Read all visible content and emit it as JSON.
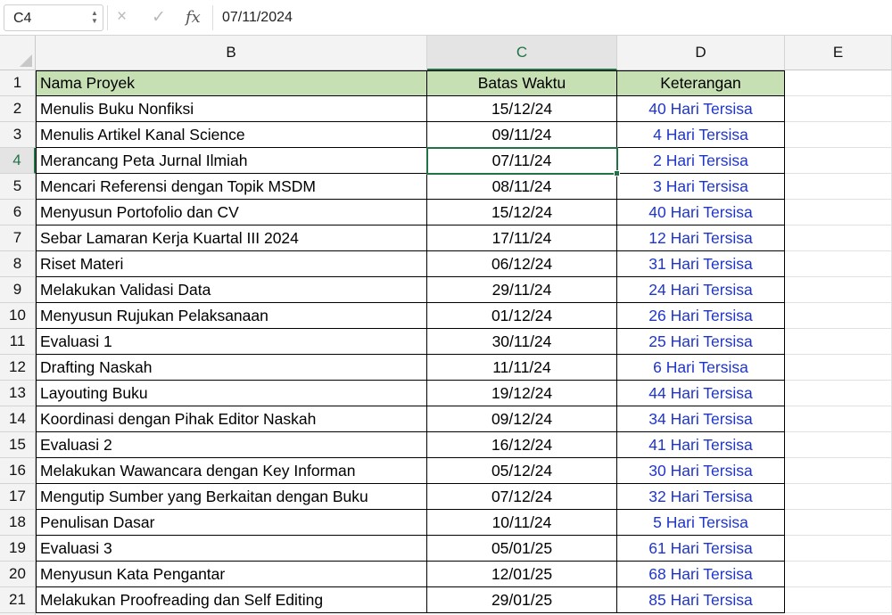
{
  "formula_bar": {
    "name_box": "C4",
    "cancel_icon": "×",
    "enter_icon": "✓",
    "fx_label": "fx",
    "value": "07/11/2024"
  },
  "columns": [
    "B",
    "C",
    "D",
    "E"
  ],
  "row_numbers": [
    "1",
    "2",
    "3",
    "4",
    "5",
    "6",
    "7",
    "8",
    "9",
    "10",
    "11",
    "12",
    "13",
    "14",
    "15",
    "16",
    "17",
    "18",
    "19",
    "20",
    "21"
  ],
  "table": {
    "headers": [
      "Nama Proyek",
      "Batas Waktu",
      "Keterangan"
    ],
    "rows": [
      [
        "Menulis Buku Nonfiksi",
        "15/12/24",
        "40 Hari Tersisa"
      ],
      [
        "Menulis Artikel Kanal Science",
        "09/11/24",
        "4 Hari Tersisa"
      ],
      [
        "Merancang Peta Jurnal Ilmiah",
        "07/11/24",
        "2 Hari Tersisa"
      ],
      [
        "Mencari Referensi dengan Topik MSDM",
        "08/11/24",
        "3 Hari Tersisa"
      ],
      [
        "Menyusun Portofolio dan CV",
        "15/12/24",
        "40 Hari Tersisa"
      ],
      [
        "Sebar Lamaran Kerja Kuartal III 2024",
        "17/11/24",
        "12 Hari Tersisa"
      ],
      [
        "Riset Materi",
        "06/12/24",
        "31 Hari Tersisa"
      ],
      [
        "Melakukan Validasi Data",
        "29/11/24",
        "24 Hari Tersisa"
      ],
      [
        "Menyusun Rujukan Pelaksanaan",
        "01/12/24",
        "26 Hari Tersisa"
      ],
      [
        "Evaluasi 1",
        "30/11/24",
        "25 Hari Tersisa"
      ],
      [
        "Drafting Naskah",
        "11/11/24",
        "6 Hari Tersisa"
      ],
      [
        "Layouting Buku",
        "19/12/24",
        "44 Hari Tersisa"
      ],
      [
        "Koordinasi dengan Pihak Editor Naskah",
        "09/12/24",
        "34 Hari Tersisa"
      ],
      [
        "Evaluasi 2",
        "16/12/24",
        "41 Hari Tersisa"
      ],
      [
        "Melakukan Wawancara dengan Key Informan",
        "05/12/24",
        "30 Hari Tersisa"
      ],
      [
        "Mengutip Sumber yang Berkaitan dengan Buku",
        "07/12/24",
        "32 Hari Tersisa"
      ],
      [
        "Penulisan Dasar",
        "10/11/24",
        "5 Hari Tersisa"
      ],
      [
        "Evaluasi 3",
        "05/01/25",
        "61 Hari Tersisa"
      ],
      [
        "Menyusun Kata Pengantar",
        "12/01/25",
        "68 Hari Tersisa"
      ],
      [
        "Melakukan Proofreading dan Self Editing",
        "29/01/25",
        "85 Hari Tersisa"
      ]
    ]
  },
  "active_cell": {
    "column": "C",
    "row": "4"
  },
  "colors": {
    "header_fill": "#c6e0b4",
    "keterangan_text": "#1f35c9",
    "selection": "#217346"
  }
}
